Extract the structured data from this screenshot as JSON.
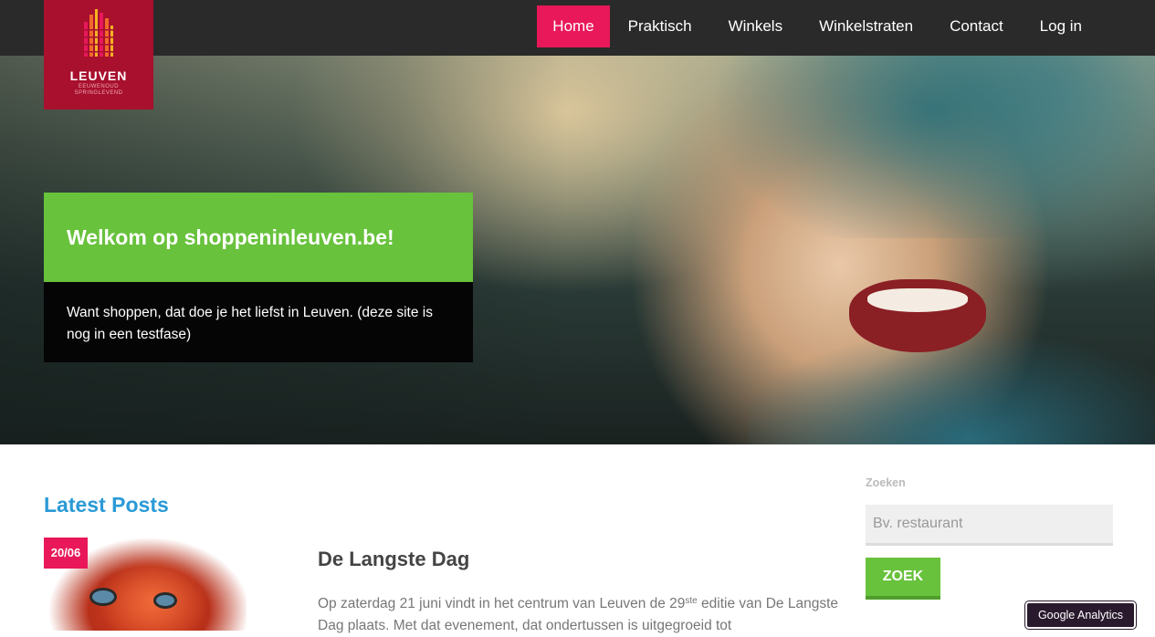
{
  "brand": {
    "name": "LEUVEN",
    "tagline_line1": "EEUWENOUD",
    "tagline_line2": "SPRINGLEVEND",
    "color": "#a8102e"
  },
  "nav": {
    "items": [
      {
        "label": "Home",
        "active": true
      },
      {
        "label": "Praktisch",
        "active": false
      },
      {
        "label": "Winkels",
        "active": false
      },
      {
        "label": "Winkelstraten",
        "active": false
      },
      {
        "label": "Contact",
        "active": false
      },
      {
        "label": "Log in",
        "active": false
      }
    ],
    "active_color": "#e8185a"
  },
  "hero": {
    "title": "Welkom op shoppeninleuven.be!",
    "text": "Want shoppen, dat doe je het liefst in Leuven. (deze site is nog in een testfase)",
    "title_bg": "#68c23c"
  },
  "content": {
    "section_title": "Latest Posts",
    "post": {
      "date": "20/06",
      "title": "De Langste Dag",
      "excerpt_part1": "Op zaterdag 21 juni vindt in het centrum van Leuven de 29",
      "excerpt_sup": "ste",
      "excerpt_part2": " editie van De Langste Dag plaats. Met dat evenement, dat ondertussen is uitgegroeid tot"
    }
  },
  "sidebar": {
    "search_label": "Zoeken",
    "search_placeholder": "Bv. restaurant",
    "search_button": "ZOEK"
  },
  "badge": {
    "label": "Google Analytics"
  }
}
